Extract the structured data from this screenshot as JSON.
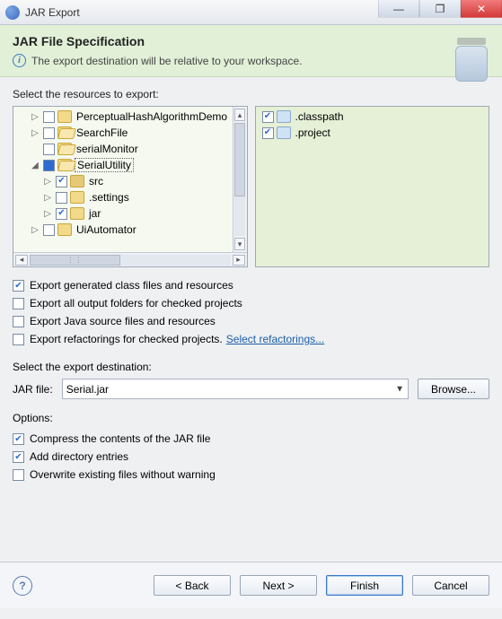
{
  "window": {
    "title": "JAR Export"
  },
  "header": {
    "title": "JAR File Specification",
    "subtitle": "The export destination will be relative to your workspace."
  },
  "resources": {
    "label": "Select the resources to export:",
    "leftTree": [
      {
        "label": "PerceptualHashAlgorithmDemo",
        "expander": "▷",
        "check": "empty",
        "indent": 1,
        "icon": "folder"
      },
      {
        "label": "SearchFile",
        "expander": "▷",
        "check": "empty",
        "indent": 1,
        "icon": "folder-open"
      },
      {
        "label": "serialMonitor",
        "expander": "",
        "check": "empty",
        "indent": 1,
        "icon": "folder-x"
      },
      {
        "label": "SerialUtility",
        "expander": "◢",
        "check": "filled",
        "indent": 1,
        "icon": "folder-open",
        "selected": true
      },
      {
        "label": "src",
        "expander": "▷",
        "check": "checked",
        "indent": 2,
        "icon": "pkg"
      },
      {
        "label": ".settings",
        "expander": "▷",
        "check": "empty",
        "indent": 2,
        "icon": "folder"
      },
      {
        "label": "jar",
        "expander": "▷",
        "check": "checked",
        "indent": 2,
        "icon": "folder"
      },
      {
        "label": "UiAutomator",
        "expander": "▷",
        "check": "empty",
        "indent": 1,
        "icon": "folder"
      }
    ],
    "rightTree": [
      {
        "label": ".classpath",
        "check": "checked",
        "icon": "xfile"
      },
      {
        "label": ".project",
        "check": "checked",
        "icon": "xfile"
      }
    ]
  },
  "exportChecks": [
    {
      "label": "Export generated class files and resources",
      "on": true
    },
    {
      "label": "Export all output folders for checked projects",
      "on": false
    },
    {
      "label": "Export Java source files and resources",
      "on": false
    },
    {
      "label": "Export refactorings for checked projects.",
      "on": false,
      "link": "Select refactorings..."
    }
  ],
  "destination": {
    "label": "Select the export destination:",
    "fieldLabel": "JAR file:",
    "value": "Serial.jar",
    "browse": "Browse..."
  },
  "options": {
    "label": "Options:",
    "items": [
      {
        "label": "Compress the contents of the JAR file",
        "on": true
      },
      {
        "label": "Add directory entries",
        "on": true
      },
      {
        "label": "Overwrite existing files without warning",
        "on": false
      }
    ]
  },
  "footer": {
    "back": "< Back",
    "next": "Next >",
    "finish": "Finish",
    "cancel": "Cancel"
  }
}
